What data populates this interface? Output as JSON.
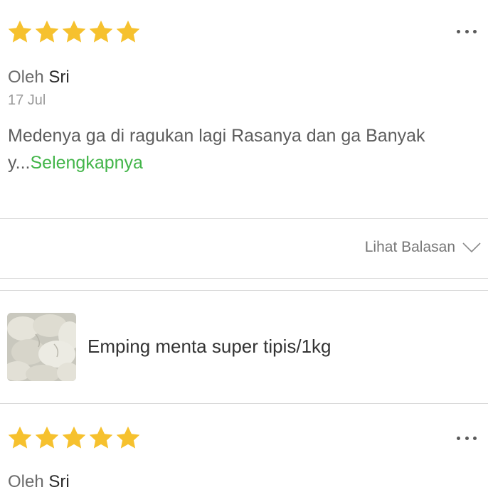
{
  "reviews": [
    {
      "rating": 5,
      "by_prefix": "Oleh",
      "author": "Sri",
      "date": "17 Jul",
      "text": "Medenya ga di ragukan lagi Rasanya dan ga Banyak y...",
      "more_label": "Selengkapnya"
    },
    {
      "rating": 5,
      "by_prefix": "Oleh",
      "author": "Sri"
    }
  ],
  "reply": {
    "label": "Lihat Balasan"
  },
  "product": {
    "name": "Emping menta super tipis/1kg"
  },
  "colors": {
    "star": "#f6c12e",
    "accent_green": "#42b549",
    "divider": "#d9d9d9"
  },
  "icons": {
    "star": "star-icon",
    "more": "more-dots-icon",
    "chevron": "chevron-down-icon"
  }
}
